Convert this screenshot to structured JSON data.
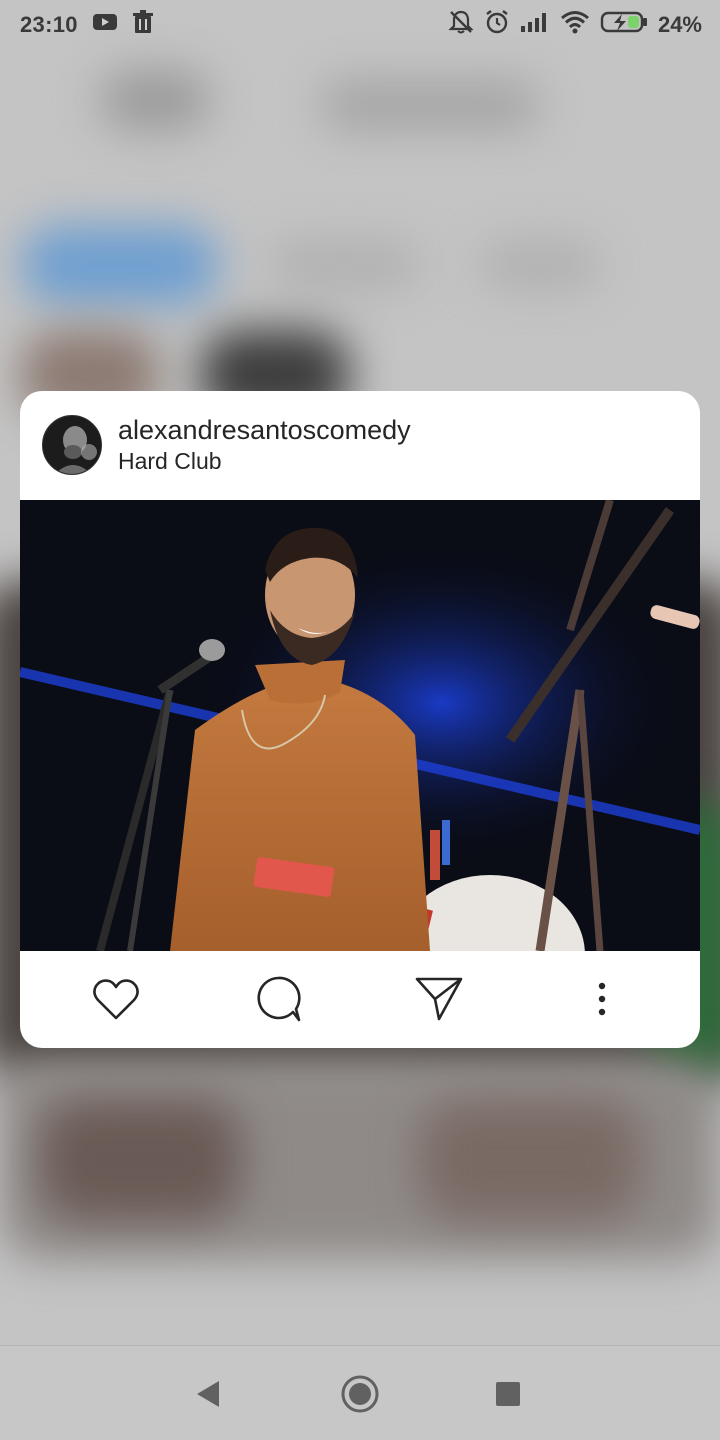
{
  "status_bar": {
    "time": "23:10",
    "left_icons": [
      "youtube-icon",
      "trash-icon"
    ],
    "right_icons": [
      "notifications-muted-icon",
      "alarm-icon",
      "signal-icon",
      "wifi-icon",
      "battery-charging-icon"
    ],
    "battery_percent": "24%"
  },
  "post": {
    "username": "alexandresantoscomedy",
    "location": "Hard Club",
    "image_alt": "Comedian on stage with microphone",
    "actions": {
      "like_icon": "heart-icon",
      "comment_icon": "comment-icon",
      "share_icon": "send-icon",
      "more_icon": "more-vertical-icon"
    }
  },
  "nav_bar": {
    "icons": [
      "back-icon",
      "home-icon",
      "recents-icon"
    ]
  },
  "colors": {
    "card_bg": "#ffffff",
    "text_primary": "#262626",
    "status_text": "#3a3a3a",
    "battery_fill": "#7cd36b"
  }
}
